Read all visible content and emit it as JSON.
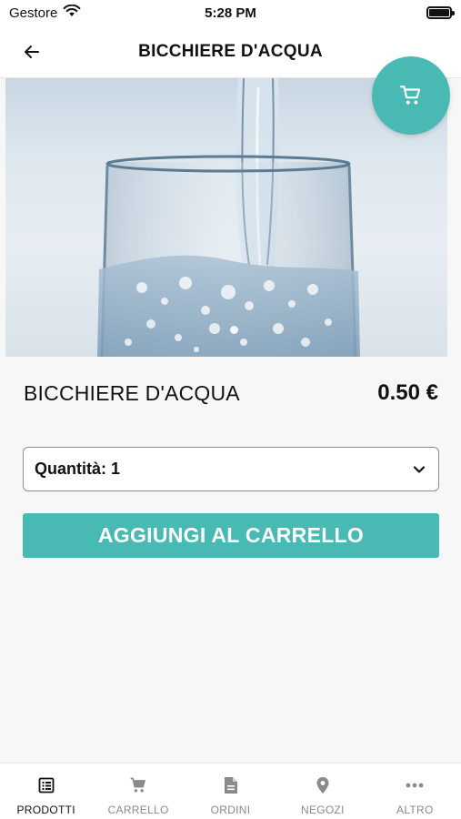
{
  "status_bar": {
    "carrier": "Gestore",
    "time": "5:28 PM"
  },
  "header": {
    "title": "BICCHIERE D'ACQUA"
  },
  "product": {
    "name": "BICCHIERE D'ACQUA",
    "price": "0.50 €",
    "image_icon": "water-glass-photo"
  },
  "quantity": {
    "label": "Quantità: 1"
  },
  "actions": {
    "add_to_cart": "AGGIUNGI AL CARRELLO"
  },
  "tabs": [
    {
      "label": "PRODOTTI",
      "icon": "list-icon",
      "active": true
    },
    {
      "label": "CARRELLO",
      "icon": "cart-icon",
      "active": false
    },
    {
      "label": "ORDINI",
      "icon": "document-icon",
      "active": false
    },
    {
      "label": "NEGOZI",
      "icon": "location-pin-icon",
      "active": false
    },
    {
      "label": "ALTRO",
      "icon": "more-icon",
      "active": false
    }
  ],
  "colors": {
    "accent": "#48b9b3",
    "background": "#f7f7f7"
  }
}
